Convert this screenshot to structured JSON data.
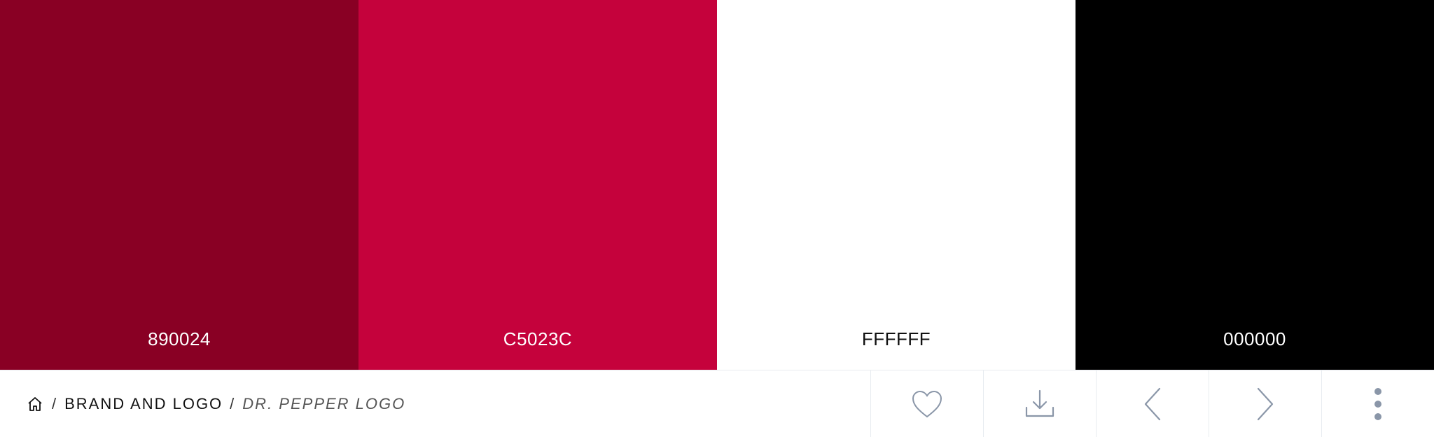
{
  "palette": {
    "swatches": [
      {
        "hex": "890024",
        "color": "#890024",
        "text_color": "#ffffff"
      },
      {
        "hex": "C5023C",
        "color": "#C5023C",
        "text_color": "#ffffff"
      },
      {
        "hex": "FFFFFF",
        "color": "#FFFFFF",
        "text_color": "#111111"
      },
      {
        "hex": "000000",
        "color": "#000000",
        "text_color": "#ffffff"
      }
    ]
  },
  "breadcrumb": {
    "home_icon": "home-icon",
    "separator": "/",
    "category": "BRAND AND LOGO",
    "current": "DR. PEPPER LOGO"
  },
  "actions": {
    "icons": [
      "heart-icon",
      "download-icon",
      "chevron-left-icon",
      "chevron-right-icon",
      "more-vertical-icon"
    ],
    "icon_color": "#8a96a8"
  }
}
